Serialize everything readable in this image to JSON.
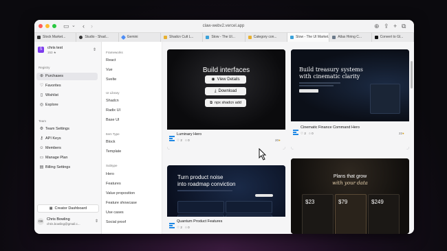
{
  "browser": {
    "url": "claw-webv2.vercel.app",
    "tabs": [
      {
        "label": "Stock Market..."
      },
      {
        "label": "Studio - Shad..."
      },
      {
        "label": "Gemini"
      },
      {
        "label": "Shadcn Cult L..."
      },
      {
        "label": "Stow - The UI..."
      },
      {
        "label": "Category con..."
      },
      {
        "label": "Stow - The UI Market..."
      },
      {
        "label": "Atlas Hiring C..."
      },
      {
        "label": "Convert to Gl..."
      }
    ]
  },
  "account": {
    "initial": "S",
    "name": "chris test",
    "sub": "153 ★"
  },
  "sidebar": {
    "registry_label": "Registry",
    "items": [
      {
        "label": "Purchases",
        "icon": "shopping-bag-icon"
      },
      {
        "label": "Favorites",
        "icon": "heart-icon"
      },
      {
        "label": "Wishlist",
        "icon": "bookmark-icon"
      },
      {
        "label": "Explore",
        "icon": "compass-icon"
      }
    ],
    "team_label": "Team",
    "team_items": [
      {
        "label": "Team Settings",
        "icon": "gear-icon"
      },
      {
        "label": "API Keys",
        "icon": "key-icon"
      },
      {
        "label": "Members",
        "icon": "users-icon"
      },
      {
        "label": "Manage Plan",
        "icon": "card-icon"
      },
      {
        "label": "Billing Settings",
        "icon": "wallet-icon"
      }
    ],
    "creator_dashboard": "Creator Dashboard",
    "user": {
      "initials": "CB",
      "name": "Chris Bowling",
      "email": "chris.bowling@gmail.c..."
    }
  },
  "filters": {
    "frameworks_label": "Frameworks",
    "frameworks": [
      "React",
      "Vue",
      "Svelte"
    ],
    "ui_library_label": "UI Library",
    "ui_libraries": [
      "Shadcn",
      "Radix UI",
      "Base UI"
    ],
    "item_type_label": "Item Type",
    "item_types": [
      "Block",
      "Template"
    ],
    "subtype_label": "Subtype",
    "subtypes": [
      "Hero",
      "Features",
      "Value proposition",
      "Feature showcase",
      "Use cases",
      "Social proof"
    ]
  },
  "cards": [
    {
      "title": "Luminary Hero",
      "likes": "2",
      "comments": "0",
      "price": "20",
      "headline": "Build interfaces",
      "actions": [
        "View Details",
        "Download",
        "npx shadcn add"
      ]
    },
    {
      "title": "Cinematic Finance Command Hero",
      "likes": "2",
      "comments": "0",
      "price": "22",
      "headline_1": "Build treasury systems",
      "headline_2": "with cinematic clarity"
    },
    {
      "title": "Quantum Product Features",
      "likes": "2",
      "comments": "0",
      "headline_1": "Turn product noise",
      "headline_2": "into roadmap conviction"
    },
    {
      "title": "",
      "headline_1": "Plans that grow",
      "headline_2": "with your data",
      "prices": [
        "$23",
        "$79",
        "$249"
      ]
    }
  ]
}
